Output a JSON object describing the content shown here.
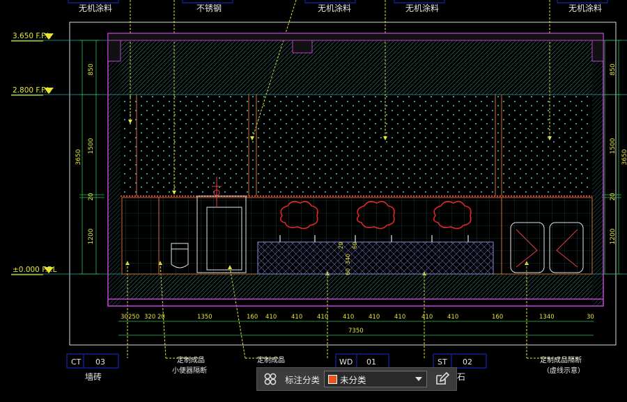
{
  "drawing": {
    "top_callouts": [
      "无机涂料",
      "不锈钢",
      "无机涂料",
      "无机涂料",
      "无机涂料"
    ],
    "level_labels": [
      "3.650 F.F.L",
      "2.800 F.F.L",
      "±0.000 F.F.L"
    ],
    "dim_left": [
      "850",
      "3650",
      "1500",
      "20",
      "1200"
    ],
    "dim_right": [
      "850",
      "3650",
      "1500",
      "20",
      "1200"
    ],
    "dim_bottom": [
      "30",
      "250",
      "320",
      "20",
      "1350",
      "160",
      "410",
      "410",
      "410",
      "410",
      "410",
      "410",
      "410",
      "410",
      "160",
      "1340",
      "30"
    ],
    "dim_total": "7350",
    "dim_inner": [
      "20",
      "60",
      "340",
      "60"
    ],
    "tags": [
      {
        "code": "CT",
        "num": "03",
        "desc": "墙砖"
      },
      {
        "code": "WD",
        "num": "01",
        "desc": ""
      },
      {
        "code": "ST",
        "num": "02",
        "desc": "石"
      }
    ],
    "bottom_notes": [
      "定制成品",
      "小便器隔断",
      "定制成品",
      "定制成品隔断",
      "（虚线示意）"
    ]
  },
  "toolbar": {
    "label": "标注分类",
    "selected": "未分类",
    "swatch_color": "#e8531f",
    "grid_icon": "grid-icon",
    "edit_icon": "edit-icon"
  }
}
